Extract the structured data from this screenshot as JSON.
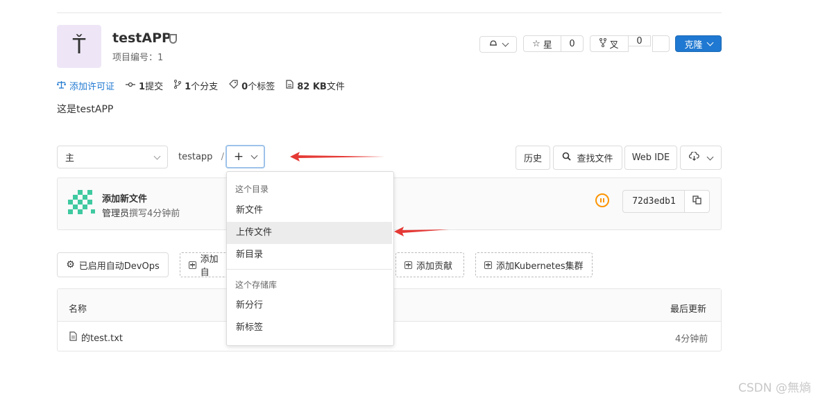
{
  "project": {
    "avatar_letter": "Ť",
    "name": "testAPP",
    "id_label": "项目编号：1",
    "description": "这是testAPP"
  },
  "header_actions": {
    "star_label": "星",
    "star_count": "0",
    "fork_label": "叉",
    "fork_count": "0",
    "clone_label": "克隆"
  },
  "stats": {
    "license": "添加许可证",
    "commits_num": "1",
    "commits_label": "提交",
    "branches_num": "1",
    "branches_label": "个分支",
    "tags_num": "0",
    "tags_label": "个标签",
    "size_num": "82 KB",
    "size_label": "文件"
  },
  "repo_toolbar": {
    "branch": "主",
    "path_root": "testapp",
    "path_sep": "/",
    "plus_label": "+",
    "history": "历史",
    "find_file": "查找文件",
    "web_ide": "Web IDE"
  },
  "dropdown": {
    "section1_header": "这个目录",
    "section1_items": [
      "新文件",
      "上传文件",
      "新目录"
    ],
    "section2_header": "这个存储库",
    "section2_items": [
      "新分行",
      "新标签"
    ],
    "highlighted": "上传文件"
  },
  "last_commit": {
    "title": "添加新文件",
    "author": "管理员",
    "meta": "撰写4分钟前",
    "sha": "72d3edb1"
  },
  "quick_actions": {
    "autodevops": "已启用自动DevOps",
    "add_readme_partial": "添加自",
    "add_contrib": "添加贡献",
    "add_k8s": "添加Kubernetes集群"
  },
  "files_table": {
    "col_name": "名称",
    "col_updated": "最后更新",
    "rows": [
      {
        "name": "的test.txt",
        "updated": "4分钟前"
      }
    ]
  },
  "watermark": "CSDN @無熵",
  "colors": {
    "accent": "#1f78d1",
    "annotation_arrow": "#e53935",
    "pipeline_running": "#fc9403"
  }
}
